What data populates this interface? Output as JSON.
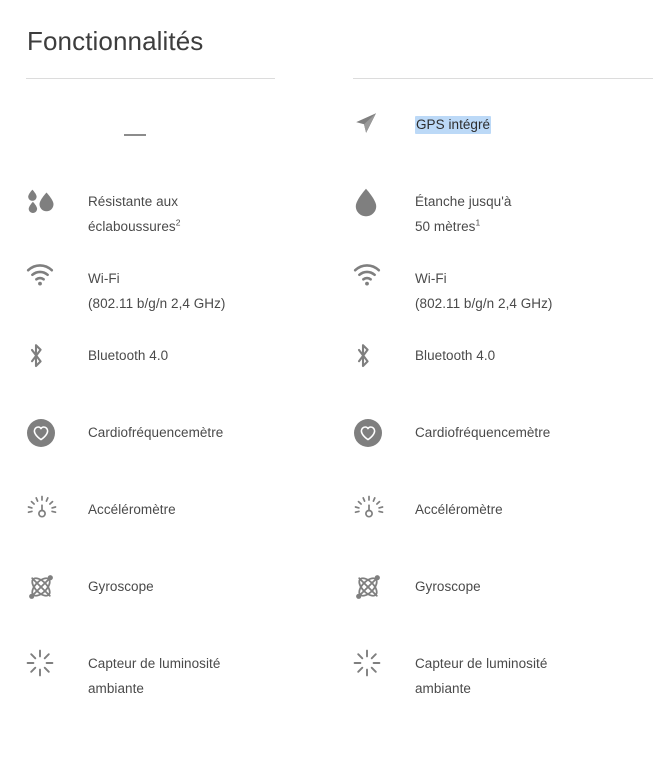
{
  "page": {
    "title": "Fonctionnalités",
    "background_color": "#ffffff",
    "text_color": "#4a4a4a",
    "icon_color": "#7f7f7f",
    "rule_color": "#dcdcdc",
    "selection_color": "#bcd9f7"
  },
  "columns": [
    {
      "id": "left",
      "rows": [
        {
          "icon": "em-dash",
          "type": "dash",
          "lines": [
            "—"
          ],
          "selected": false
        },
        {
          "icon": "water-droplets-icon",
          "type": "feature",
          "lines": [
            "Résistante aux",
            "éclaboussures"
          ],
          "footnote": "2",
          "selected": false
        },
        {
          "icon": "wifi-icon",
          "type": "feature",
          "lines": [
            "Wi-Fi",
            "(802.11 b/g/n 2,4 GHz)"
          ],
          "footnote": "",
          "selected": false
        },
        {
          "icon": "bluetooth-icon",
          "type": "feature",
          "lines": [
            "Bluetooth 4.0"
          ],
          "footnote": "",
          "selected": false
        },
        {
          "icon": "heart-rate-icon",
          "type": "feature",
          "lines": [
            "Cardiofréquencemètre"
          ],
          "footnote": "",
          "selected": false
        },
        {
          "icon": "accelerometer-icon",
          "type": "feature",
          "lines": [
            "Accéléromètre"
          ],
          "footnote": "",
          "selected": false
        },
        {
          "icon": "gyroscope-icon",
          "type": "feature",
          "lines": [
            "Gyroscope"
          ],
          "footnote": "",
          "selected": false
        },
        {
          "icon": "ambient-light-icon",
          "type": "feature",
          "lines": [
            "Capteur de luminosité",
            "ambiante"
          ],
          "footnote": "",
          "selected": false
        }
      ]
    },
    {
      "id": "right",
      "rows": [
        {
          "icon": "gps-arrow-icon",
          "type": "feature",
          "lines": [
            "GPS intégré"
          ],
          "footnote": "",
          "selected": true
        },
        {
          "icon": "water-droplet-icon",
          "type": "feature",
          "lines": [
            "Étanche jusqu'à",
            "50 mètres"
          ],
          "footnote": "1",
          "selected": false
        },
        {
          "icon": "wifi-icon",
          "type": "feature",
          "lines": [
            "Wi-Fi",
            "(802.11 b/g/n 2,4 GHz)"
          ],
          "footnote": "",
          "selected": false
        },
        {
          "icon": "bluetooth-icon",
          "type": "feature",
          "lines": [
            "Bluetooth 4.0"
          ],
          "footnote": "",
          "selected": false
        },
        {
          "icon": "heart-rate-icon",
          "type": "feature",
          "lines": [
            "Cardiofréquencemètre"
          ],
          "footnote": "",
          "selected": false
        },
        {
          "icon": "accelerometer-icon",
          "type": "feature",
          "lines": [
            "Accéléromètre"
          ],
          "footnote": "",
          "selected": false
        },
        {
          "icon": "gyroscope-icon",
          "type": "feature",
          "lines": [
            "Gyroscope"
          ],
          "footnote": "",
          "selected": false
        },
        {
          "icon": "ambient-light-icon",
          "type": "feature",
          "lines": [
            "Capteur de luminosité",
            "ambiante"
          ],
          "footnote": "",
          "selected": false
        }
      ]
    }
  ]
}
